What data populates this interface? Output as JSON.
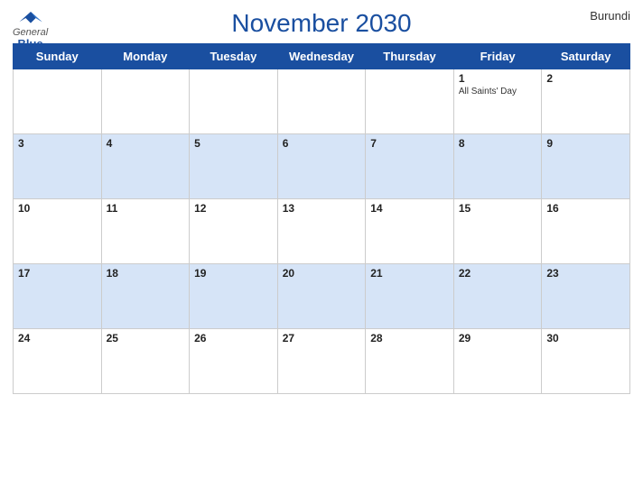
{
  "header": {
    "logo_general": "General",
    "logo_blue": "Blue",
    "title": "November 2030",
    "country": "Burundi"
  },
  "days": [
    "Sunday",
    "Monday",
    "Tuesday",
    "Wednesday",
    "Thursday",
    "Friday",
    "Saturday"
  ],
  "weeks": [
    [
      {
        "date": "",
        "holiday": ""
      },
      {
        "date": "",
        "holiday": ""
      },
      {
        "date": "",
        "holiday": ""
      },
      {
        "date": "",
        "holiday": ""
      },
      {
        "date": "",
        "holiday": ""
      },
      {
        "date": "1",
        "holiday": "All Saints' Day"
      },
      {
        "date": "2",
        "holiday": ""
      }
    ],
    [
      {
        "date": "3",
        "holiday": ""
      },
      {
        "date": "4",
        "holiday": ""
      },
      {
        "date": "5",
        "holiday": ""
      },
      {
        "date": "6",
        "holiday": ""
      },
      {
        "date": "7",
        "holiday": ""
      },
      {
        "date": "8",
        "holiday": ""
      },
      {
        "date": "9",
        "holiday": ""
      }
    ],
    [
      {
        "date": "10",
        "holiday": ""
      },
      {
        "date": "11",
        "holiday": ""
      },
      {
        "date": "12",
        "holiday": ""
      },
      {
        "date": "13",
        "holiday": ""
      },
      {
        "date": "14",
        "holiday": ""
      },
      {
        "date": "15",
        "holiday": ""
      },
      {
        "date": "16",
        "holiday": ""
      }
    ],
    [
      {
        "date": "17",
        "holiday": ""
      },
      {
        "date": "18",
        "holiday": ""
      },
      {
        "date": "19",
        "holiday": ""
      },
      {
        "date": "20",
        "holiday": ""
      },
      {
        "date": "21",
        "holiday": ""
      },
      {
        "date": "22",
        "holiday": ""
      },
      {
        "date": "23",
        "holiday": ""
      }
    ],
    [
      {
        "date": "24",
        "holiday": ""
      },
      {
        "date": "25",
        "holiday": ""
      },
      {
        "date": "26",
        "holiday": ""
      },
      {
        "date": "27",
        "holiday": ""
      },
      {
        "date": "28",
        "holiday": ""
      },
      {
        "date": "29",
        "holiday": ""
      },
      {
        "date": "30",
        "holiday": ""
      }
    ]
  ],
  "row_colors": [
    "white",
    "blue",
    "white",
    "blue",
    "white"
  ]
}
